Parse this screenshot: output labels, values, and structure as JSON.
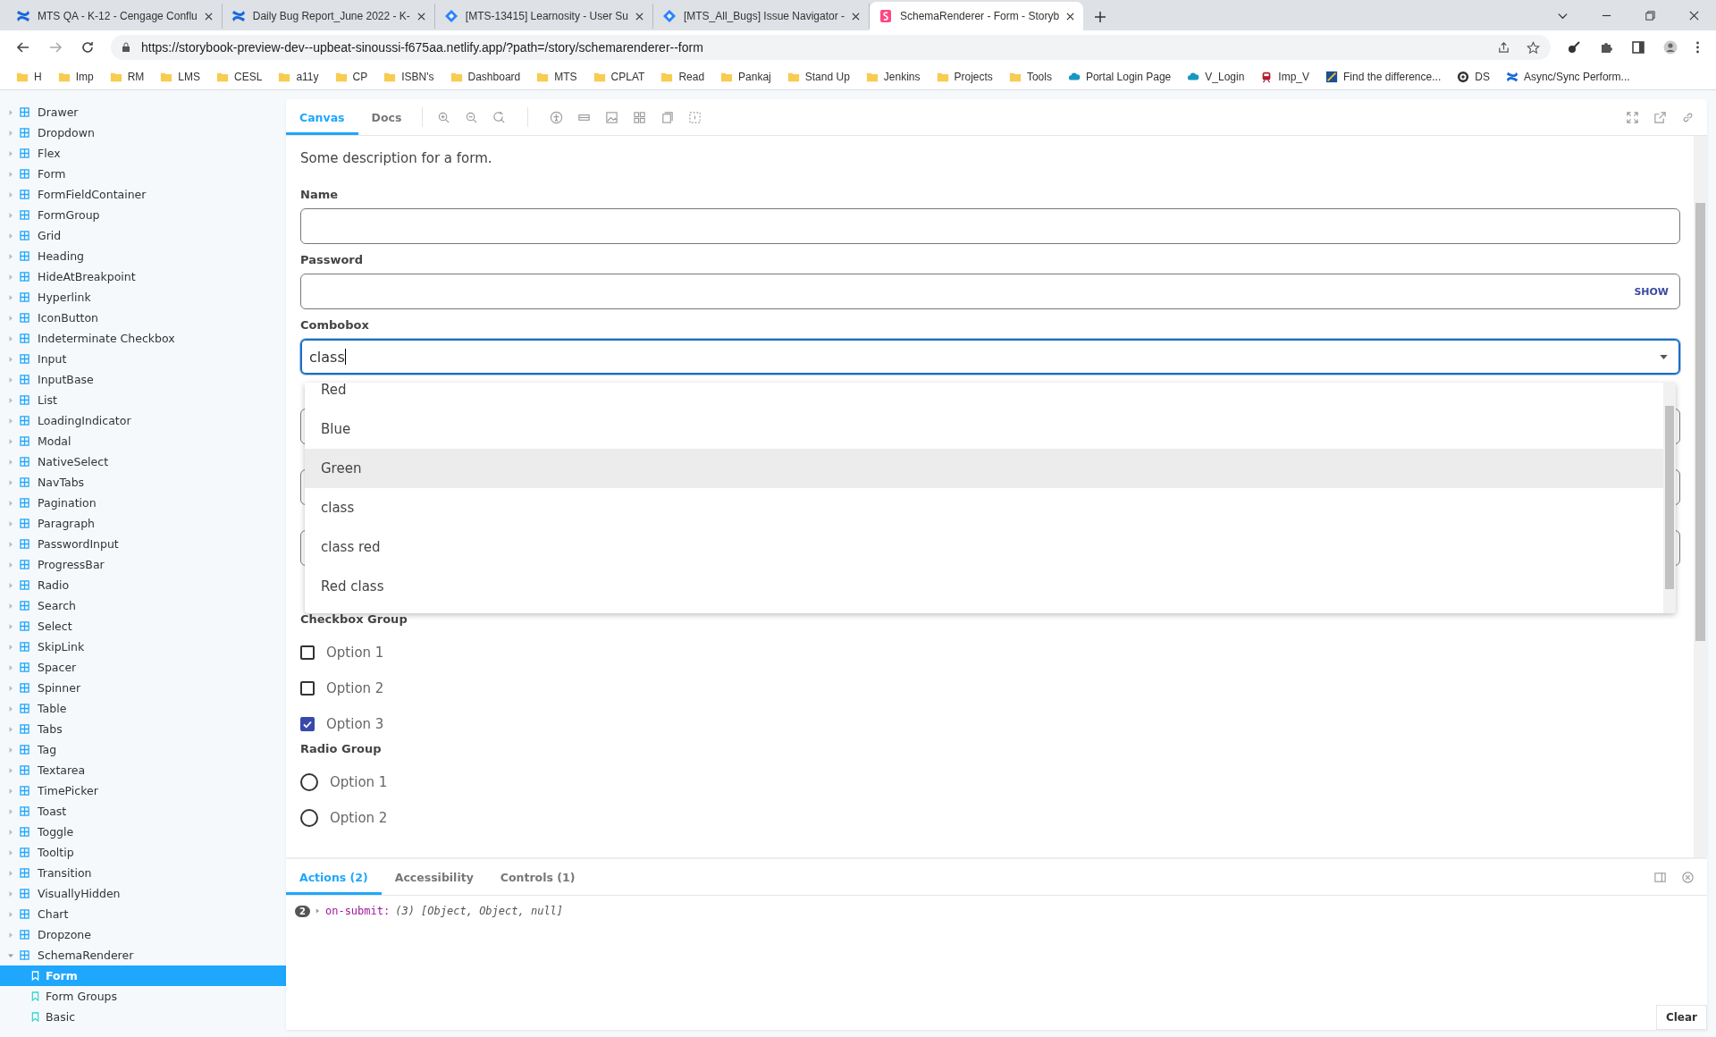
{
  "browser": {
    "tabs": [
      {
        "title": "MTS QA - K-12 - Cengage Conflu",
        "selected": false,
        "kind": "confluence"
      },
      {
        "title": "Daily Bug Report_June 2022 - K-",
        "selected": false,
        "kind": "confluence"
      },
      {
        "title": "[MTS-13415] Learnosity - User Su",
        "selected": false,
        "kind": "jira"
      },
      {
        "title": "[MTS_All_Bugs] Issue Navigator -",
        "selected": false,
        "kind": "jira"
      },
      {
        "title": "SchemaRenderer - Form - Storyb",
        "selected": true,
        "kind": "storybook"
      }
    ],
    "url": "https://storybook-preview-dev--upbeat-sinoussi-f675aa.netlify.app/?path=/story/schemarenderer--form",
    "bookmarks": [
      {
        "label": "H",
        "kind": "folder"
      },
      {
        "label": "Imp",
        "kind": "folder"
      },
      {
        "label": "RM",
        "kind": "folder"
      },
      {
        "label": "LMS",
        "kind": "folder"
      },
      {
        "label": "CESL",
        "kind": "folder"
      },
      {
        "label": "a11y",
        "kind": "folder"
      },
      {
        "label": "CP",
        "kind": "folder"
      },
      {
        "label": "ISBN's",
        "kind": "folder"
      },
      {
        "label": "Dashboard",
        "kind": "folder"
      },
      {
        "label": "MTS",
        "kind": "folder"
      },
      {
        "label": "CPLAT",
        "kind": "folder"
      },
      {
        "label": "Read",
        "kind": "folder"
      },
      {
        "label": "Pankaj",
        "kind": "folder"
      },
      {
        "label": "Stand Up",
        "kind": "folder"
      },
      {
        "label": "Jenkins",
        "kind": "folder"
      },
      {
        "label": "Projects",
        "kind": "folder"
      },
      {
        "label": "Tools",
        "kind": "folder"
      },
      {
        "label": "Portal Login Page",
        "kind": "cloud"
      },
      {
        "label": "V_Login",
        "kind": "cloud"
      },
      {
        "label": "Imp_V",
        "kind": "train"
      },
      {
        "label": "Find the difference...",
        "kind": "site"
      },
      {
        "label": "DS",
        "kind": "badge"
      },
      {
        "label": "Async/Sync Perform...",
        "kind": "confluence"
      }
    ]
  },
  "sidebar": {
    "items": [
      {
        "label": "Drawer",
        "kind": "component",
        "expanded": false
      },
      {
        "label": "Dropdown",
        "kind": "component",
        "expanded": false
      },
      {
        "label": "Flex",
        "kind": "component",
        "expanded": false
      },
      {
        "label": "Form",
        "kind": "component",
        "expanded": false
      },
      {
        "label": "FormFieldContainer",
        "kind": "component",
        "expanded": false
      },
      {
        "label": "FormGroup",
        "kind": "component",
        "expanded": false
      },
      {
        "label": "Grid",
        "kind": "component",
        "expanded": false
      },
      {
        "label": "Heading",
        "kind": "component",
        "expanded": false
      },
      {
        "label": "HideAtBreakpoint",
        "kind": "component",
        "expanded": false
      },
      {
        "label": "Hyperlink",
        "kind": "component",
        "expanded": false
      },
      {
        "label": "IconButton",
        "kind": "component",
        "expanded": false
      },
      {
        "label": "Indeterminate Checkbox",
        "kind": "component",
        "expanded": false
      },
      {
        "label": "Input",
        "kind": "component",
        "expanded": false
      },
      {
        "label": "InputBase",
        "kind": "component",
        "expanded": false
      },
      {
        "label": "List",
        "kind": "component",
        "expanded": false
      },
      {
        "label": "LoadingIndicator",
        "kind": "component",
        "expanded": false
      },
      {
        "label": "Modal",
        "kind": "component",
        "expanded": false
      },
      {
        "label": "NativeSelect",
        "kind": "component",
        "expanded": false
      },
      {
        "label": "NavTabs",
        "kind": "component",
        "expanded": false
      },
      {
        "label": "Pagination",
        "kind": "component",
        "expanded": false
      },
      {
        "label": "Paragraph",
        "kind": "component",
        "expanded": false
      },
      {
        "label": "PasswordInput",
        "kind": "component",
        "expanded": false
      },
      {
        "label": "ProgressBar",
        "kind": "component",
        "expanded": false
      },
      {
        "label": "Radio",
        "kind": "component",
        "expanded": false
      },
      {
        "label": "Search",
        "kind": "component",
        "expanded": false
      },
      {
        "label": "Select",
        "kind": "component",
        "expanded": false
      },
      {
        "label": "SkipLink",
        "kind": "component",
        "expanded": false
      },
      {
        "label": "Spacer",
        "kind": "component",
        "expanded": false
      },
      {
        "label": "Spinner",
        "kind": "component",
        "expanded": false
      },
      {
        "label": "Table",
        "kind": "component",
        "expanded": false
      },
      {
        "label": "Tabs",
        "kind": "component",
        "expanded": false
      },
      {
        "label": "Tag",
        "kind": "component",
        "expanded": false
      },
      {
        "label": "Textarea",
        "kind": "component",
        "expanded": false
      },
      {
        "label": "TimePicker",
        "kind": "component",
        "expanded": false
      },
      {
        "label": "Toast",
        "kind": "component",
        "expanded": false
      },
      {
        "label": "Toggle",
        "kind": "component",
        "expanded": false
      },
      {
        "label": "Tooltip",
        "kind": "component",
        "expanded": false
      },
      {
        "label": "Transition",
        "kind": "component",
        "expanded": false
      },
      {
        "label": "VisuallyHidden",
        "kind": "component",
        "expanded": false
      },
      {
        "label": "Chart",
        "kind": "component",
        "expanded": false
      },
      {
        "label": "Dropzone",
        "kind": "component",
        "expanded": false
      },
      {
        "label": "SchemaRenderer",
        "kind": "component",
        "expanded": true,
        "children": [
          {
            "label": "Form",
            "kind": "story",
            "selected": true
          },
          {
            "label": "Form Groups",
            "kind": "story",
            "selected": false
          },
          {
            "label": "Basic",
            "kind": "story",
            "selected": false
          }
        ]
      }
    ]
  },
  "toolbar": {
    "tabs": [
      {
        "label": "Canvas",
        "selected": true
      },
      {
        "label": "Docs",
        "selected": false
      }
    ]
  },
  "form": {
    "description": "Some description for a form.",
    "fields": [
      {
        "label": "Name",
        "kind": "text",
        "focused": false
      },
      {
        "label": "Password",
        "kind": "password",
        "action": "SHOW",
        "focused": false
      },
      {
        "label": "Combobox",
        "kind": "combobox",
        "value": "class",
        "focused": true
      }
    ],
    "options": [
      {
        "label": "Red",
        "highlighted": false
      },
      {
        "label": "Blue",
        "highlighted": false
      },
      {
        "label": "Green",
        "highlighted": true
      },
      {
        "label": "class",
        "highlighted": false
      },
      {
        "label": "class red",
        "highlighted": false
      },
      {
        "label": "Red class",
        "highlighted": false
      }
    ],
    "checkbox_group": {
      "label": "Checkbox Group",
      "options": [
        {
          "label": "Option 1",
          "checked": false
        },
        {
          "label": "Option 2",
          "checked": false
        },
        {
          "label": "Option 3",
          "checked": true
        }
      ]
    },
    "radio_group": {
      "label": "Radio Group",
      "options": [
        {
          "label": "Option 1",
          "selected": false
        },
        {
          "label": "Option 2",
          "selected": false
        }
      ]
    }
  },
  "addons": {
    "tabs": [
      {
        "label": "Actions (2)",
        "selected": true
      },
      {
        "label": "Accessibility",
        "selected": false
      },
      {
        "label": "Controls (1)",
        "selected": false
      }
    ],
    "log": [
      {
        "count": "2",
        "name": "on-submit:",
        "args": "(3) [Object, Object, null]"
      }
    ],
    "clear": "Clear"
  }
}
